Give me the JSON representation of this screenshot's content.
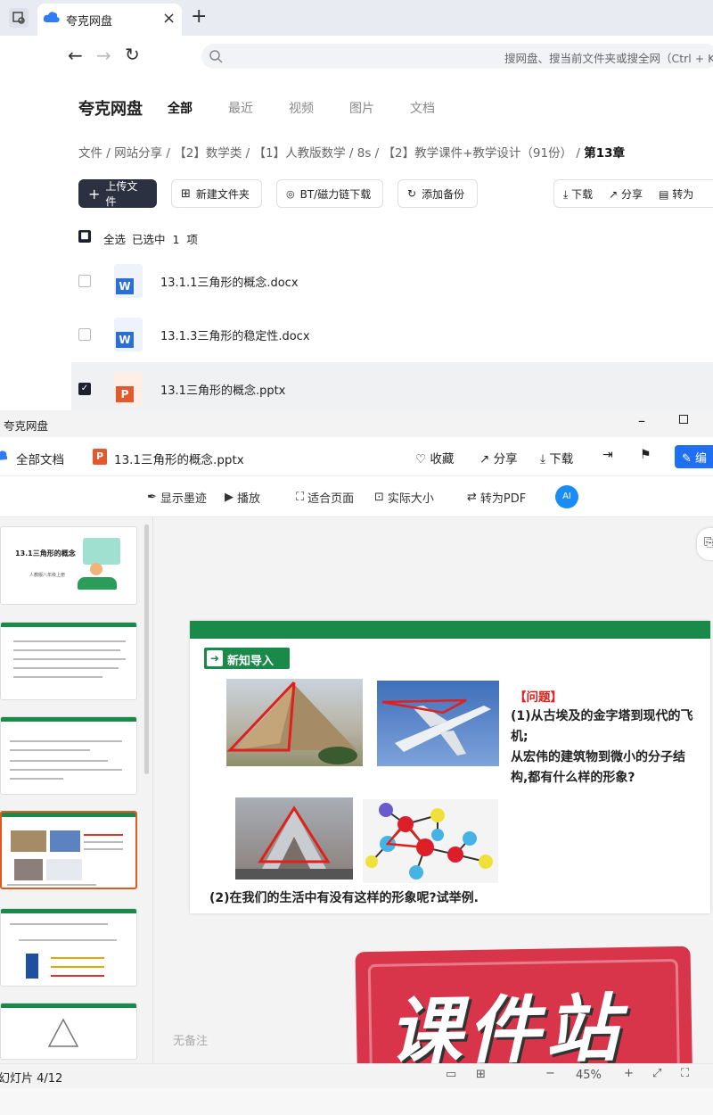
{
  "browser": {
    "tab_title": "夸克网盘",
    "address_placeholder": "搜网盘、搜当前文件夹或搜全网（Ctrl + K）"
  },
  "app": {
    "logo": "夸克网盘",
    "nav_tabs": [
      "全部",
      "最近",
      "视频",
      "图片",
      "文档"
    ],
    "breadcrumb": [
      "文件",
      "网站分享",
      "【2】数学类",
      "【1】人教版数学",
      "8s",
      "【2】教学课件+教学设计（91份）",
      "第13章"
    ],
    "toolbar": {
      "upload": "上传文件",
      "new_folder": "新建文件夹",
      "bt": "BT/磁力链下载",
      "backup": "添加备份",
      "download": "下载",
      "share": "分享",
      "to_pdf": "转为"
    },
    "select_all": "全选",
    "selected_count": "已选中  1  项",
    "files": [
      {
        "name": "13.1.1三角形的概念.docx",
        "type": "word",
        "checked": false
      },
      {
        "name": "13.1.3三角形的稳定性.docx",
        "type": "word",
        "checked": false
      },
      {
        "name": "13.1三角形的概念.pptx",
        "type": "ppt",
        "checked": true
      }
    ]
  },
  "preview": {
    "window_title": "夸克网盘",
    "all_docs": "全部文档",
    "file_name": "13.1三角形的概念.pptx",
    "collect": "收藏",
    "share": "分享",
    "download": "下载",
    "edit": "编",
    "tools": {
      "ink": "显示墨迹",
      "play": "播放",
      "fit": "适合页面",
      "actual": "实际大小",
      "to_pdf": "转为PDF",
      "ai": "AI"
    },
    "thumbs": {
      "t1_title": "13.1三角形的概念",
      "t1_sub": "人教版八年级上册"
    },
    "slide": {
      "section": "新知导入",
      "question_label": "【问题】",
      "q1": "(1)从古埃及的金字塔到现代的飞机;",
      "q1b": "从宏伟的建筑物到微小的分子结构,都有什么样的形象?",
      "q2": "(2)在我们的生活中有没有这样的形象呢?试举例."
    },
    "no_notes": "无备注",
    "status": "幻灯片 4/12",
    "zoom": "45%",
    "watermark": "课件站"
  },
  "colors": {
    "accent_blue": "#1f6ff2",
    "slide_green": "#1a8a4a",
    "question_red": "#e0201b",
    "watermark_red": "#d9354a"
  }
}
